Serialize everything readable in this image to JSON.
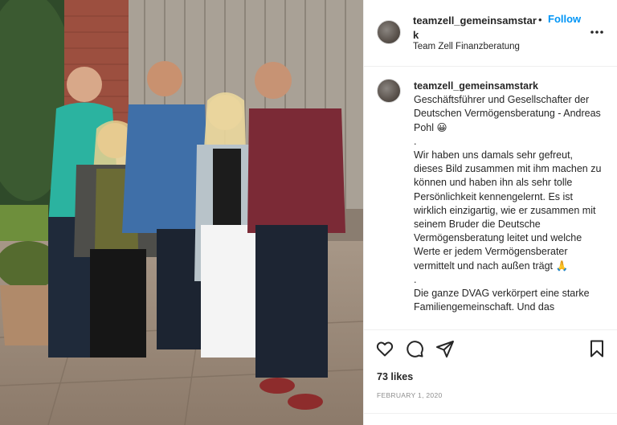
{
  "header": {
    "username": "teamzell_gemeinsamstark",
    "separator": "•",
    "follow_label": "Follow",
    "subtitle": "Team Zell Finanzberatung",
    "more_icon": "more-horizontal-icon"
  },
  "caption": {
    "username": "teamzell_gemeinsamstark",
    "lines": [
      "Geschäftsführer und Gesellschafter der Deutschen Vermögensberatung - Andreas Pohl 😀",
      ".",
      "Wir haben uns damals sehr gefreut, dieses Bild zusammen mit ihm machen zu können und haben ihn als sehr tolle Persönlichkeit kennengelernt. Es ist wirklich einzigartig, wie er zusammen mit seinem Bruder die Deutsche Vermögensberatung leitet und welche Werte er jedem Vermögensberater vermittelt und nach außen trägt 🙏",
      ".",
      "Die ganze DVAG verkörpert eine starke Familiengemeinschaft. Und das"
    ]
  },
  "actions": {
    "like_icon": "heart-icon",
    "comment_icon": "comment-icon",
    "share_icon": "share-icon",
    "save_icon": "bookmark-icon"
  },
  "likes": "73 likes",
  "date": "FEBRUARY 1, 2020",
  "colors": {
    "follow": "#0095f6",
    "text": "#262626",
    "muted": "#8e8e8e",
    "divider": "#efefef"
  }
}
